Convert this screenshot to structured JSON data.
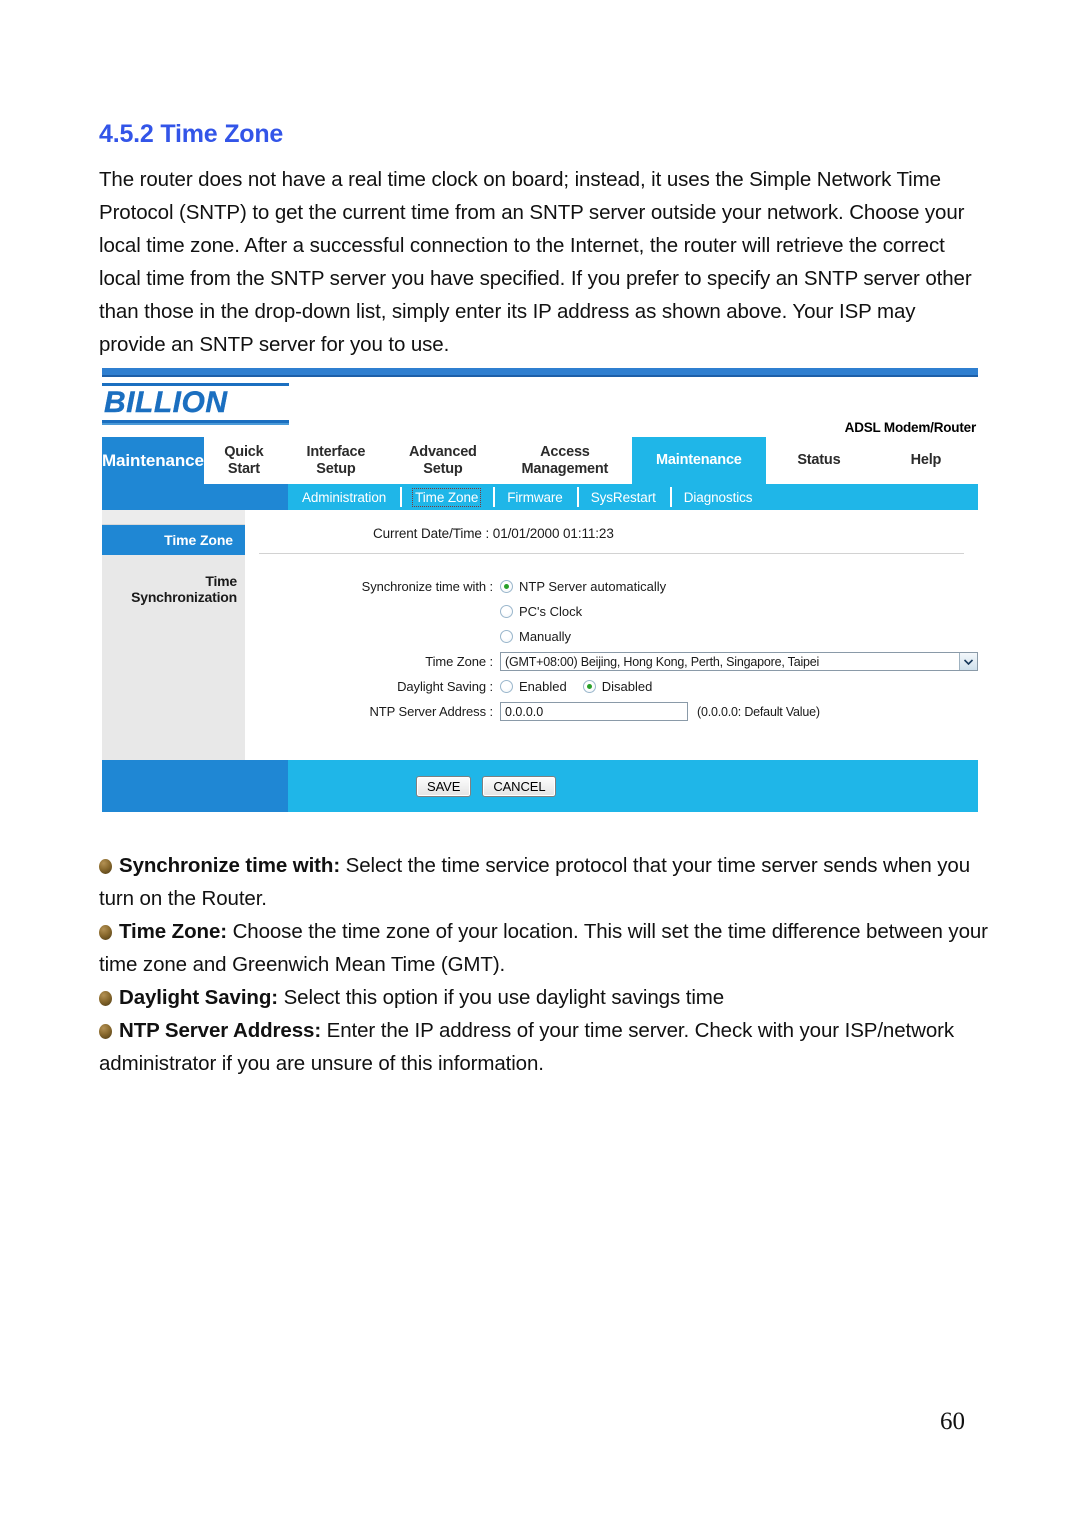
{
  "document": {
    "heading": "4.5.2 Time Zone",
    "paragraph": "The router does not have a real time clock on board; instead, it uses the Simple Network Time Protocol (SNTP) to get the current time from an SNTP server outside your network. Choose your local time zone. After a successful connection to the Internet, the router will retrieve the correct local time from the SNTP server you have specified. If you prefer to specify an SNTP server other than those in the drop-down list, simply enter its IP address as shown above. Your ISP may provide an SNTP server for you to use.",
    "page_number": "60",
    "heading_color": "#3355e8"
  },
  "router_ui": {
    "brand": "BILLION",
    "product_label": "ADSL Modem/Router",
    "active_section": "Maintenance",
    "accent_blue": "#1f87d4",
    "accent_cyan": "#1fb6e8",
    "nav_tabs": [
      {
        "line1": "Quick",
        "line2": "Start",
        "active": false
      },
      {
        "line1": "Interface",
        "line2": "Setup",
        "active": false
      },
      {
        "line1": "Advanced",
        "line2": "Setup",
        "active": false
      },
      {
        "line1": "Access",
        "line2": "Management",
        "active": false
      },
      {
        "line1": "Maintenance",
        "line2": "",
        "active": true
      },
      {
        "line1": "Status",
        "line2": "",
        "active": false
      },
      {
        "line1": "Help",
        "line2": "",
        "active": false
      }
    ],
    "sub_tabs": [
      {
        "label": "Administration",
        "active": false
      },
      {
        "label": "Time Zone",
        "active": true
      },
      {
        "label": "Firmware",
        "active": false
      },
      {
        "label": "SysRestart",
        "active": false
      },
      {
        "label": "Diagnostics",
        "active": false
      }
    ],
    "sidebar": {
      "item_label": "Time Zone",
      "section_label": "Time Synchronization"
    },
    "current_datetime_label": "Current Date/Time :  01/01/2000 01:11:23",
    "form": {
      "sync_label": "Synchronize time with :",
      "sync_options": [
        {
          "label": "NTP Server automatically",
          "selected": true
        },
        {
          "label": "PC's Clock",
          "selected": false
        },
        {
          "label": "Manually",
          "selected": false
        }
      ],
      "timezone_label": "Time Zone :",
      "timezone_value": "(GMT+08:00) Beijing, Hong Kong, Perth, Singapore, Taipei",
      "daylight_label": "Daylight Saving :",
      "daylight_options": [
        {
          "label": "Enabled",
          "selected": false
        },
        {
          "label": "Disabled",
          "selected": true
        }
      ],
      "ntp_label": "NTP Server Address :",
      "ntp_value": "0.0.0.0",
      "ntp_hint": "(0.0.0.0: Default Value)"
    },
    "buttons": {
      "save": "SAVE",
      "cancel": "CANCEL"
    }
  },
  "bullets": [
    {
      "term": "Synchronize time with:",
      "text": " Select the time service protocol that your time server sends when you turn on the Router."
    },
    {
      "term": "Time Zone:",
      "text": " Choose the time zone of your location. This will set the time difference between your time zone and Greenwich Mean Time (GMT)."
    },
    {
      "term": "Daylight Saving:",
      "text": " Select this option if you use daylight savings time"
    },
    {
      "term": "NTP Server Address:",
      "text": " Enter the IP address of your time server. Check with your ISP/network administrator if you are unsure of this information."
    }
  ]
}
